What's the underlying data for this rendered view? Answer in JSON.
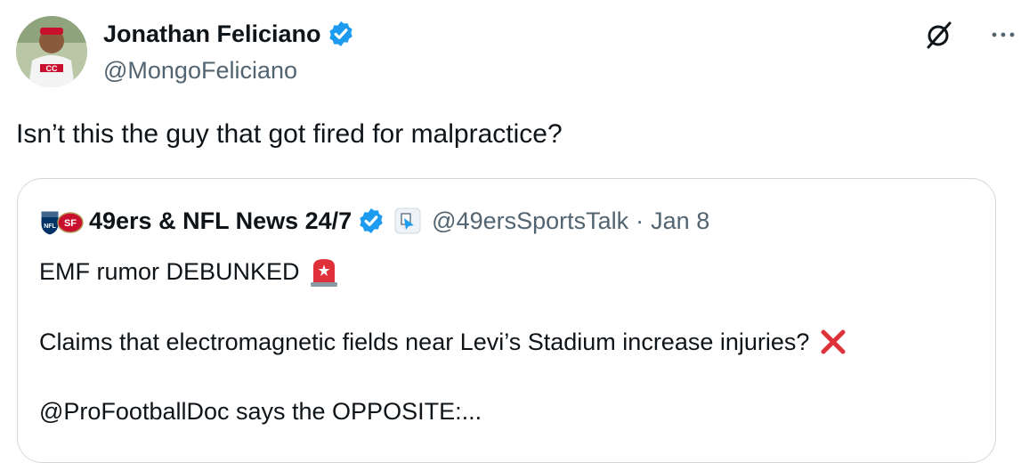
{
  "author": {
    "name": "Jonathan Feliciano",
    "handle": "@MongoFeliciano"
  },
  "tweet": {
    "text": "Isn’t this the guy that got fired for malpractice?"
  },
  "quote": {
    "name": "49ers & NFL News 24/7",
    "handle": "@49ersSportsTalk",
    "separator": "·",
    "date": "Jan 8",
    "line1": "EMF rumor DEBUNKED",
    "line2": "Claims that electromagnetic fields near Levi’s Stadium increase injuries?",
    "line3": "@ProFootballDoc says the OPPOSITE:..."
  },
  "colors": {
    "verified": "#1d9bf0",
    "secondary_text": "#536471",
    "border": "#cfd9de",
    "niners_red": "#c8102e",
    "siren_red": "#e0303a"
  },
  "icons": [
    "verified-badge-icon",
    "grok-icon",
    "more-icon",
    "nfl-shield-icon",
    "niners-logo-icon",
    "affiliate-badge-icon",
    "siren-emoji-icon",
    "cross-mark-emoji-icon"
  ]
}
